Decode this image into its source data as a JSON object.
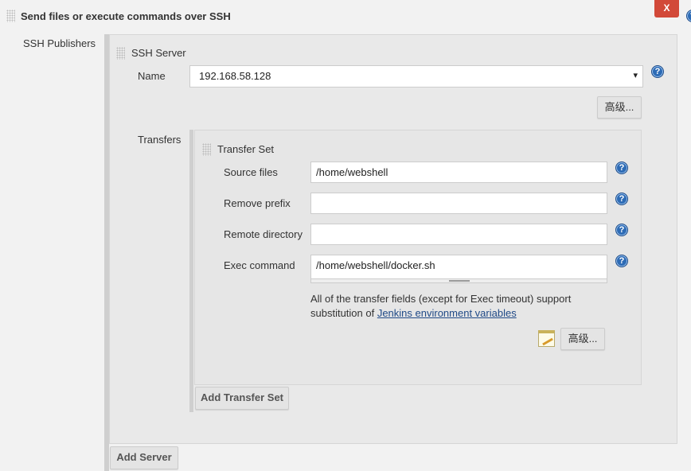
{
  "section_title": "Send files or execute commands over SSH",
  "close_label": "X",
  "ssh_publishers_label": "SSH Publishers",
  "ssh_server": {
    "title": "SSH Server",
    "name_label": "Name",
    "name_value": "192.168.58.128",
    "advanced_label": "高级..."
  },
  "transfers_label": "Transfers",
  "transfer_set": {
    "title": "Transfer Set",
    "fields": [
      {
        "label": "Source files",
        "value": "/home/webshell"
      },
      {
        "label": "Remove prefix",
        "value": ""
      },
      {
        "label": "Remote directory",
        "value": ""
      },
      {
        "label": "Exec command",
        "value": "/home/webshell/docker.sh"
      }
    ],
    "note_text": "All of the transfer fields (except for Exec timeout) support substitution of ",
    "note_link": "Jenkins environment variables",
    "advanced_label": "高级..."
  },
  "add_transfer_set_label": "Add Transfer Set",
  "add_server_label": "Add Server",
  "help_glyph": "?",
  "dropdown_glyph": "▾"
}
